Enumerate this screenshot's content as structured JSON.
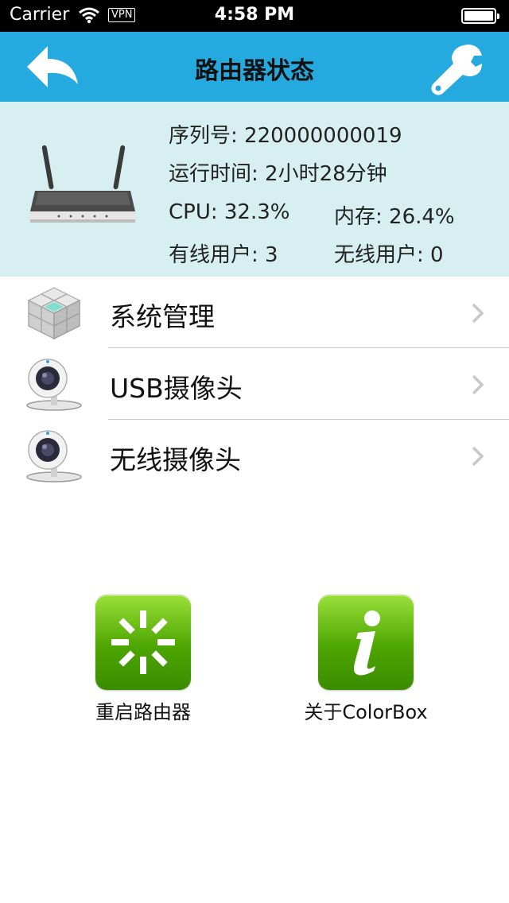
{
  "status_bar": {
    "carrier": "Carrier",
    "vpn": "VPN",
    "time": "4:58 PM"
  },
  "nav": {
    "title": "路由器状态",
    "back_icon": "back-arrow-icon",
    "settings_icon": "wrench-icon",
    "bar_color": "#25aadf"
  },
  "router": {
    "serial_label": "序列号: 220000000019",
    "uptime_label": "运行时间: 2小时28分钟",
    "cpu_label": "CPU: 32.3%",
    "memory_label": "内存: 26.4%",
    "wired_users_label": "有线用户: 3",
    "wireless_users_label": "无线用户: 0"
  },
  "menu": {
    "items": [
      {
        "label": "系统管理",
        "icon": "cube-icon"
      },
      {
        "label": "USB摄像头",
        "icon": "webcam-icon"
      },
      {
        "label": "无线摄像头",
        "icon": "webcam-icon"
      }
    ]
  },
  "actions": {
    "restart_label": "重启路由器",
    "about_label": "关于ColorBox",
    "restart_icon": "loading-spinner-icon",
    "about_icon": "info-icon",
    "tile_color": "#4da500"
  }
}
